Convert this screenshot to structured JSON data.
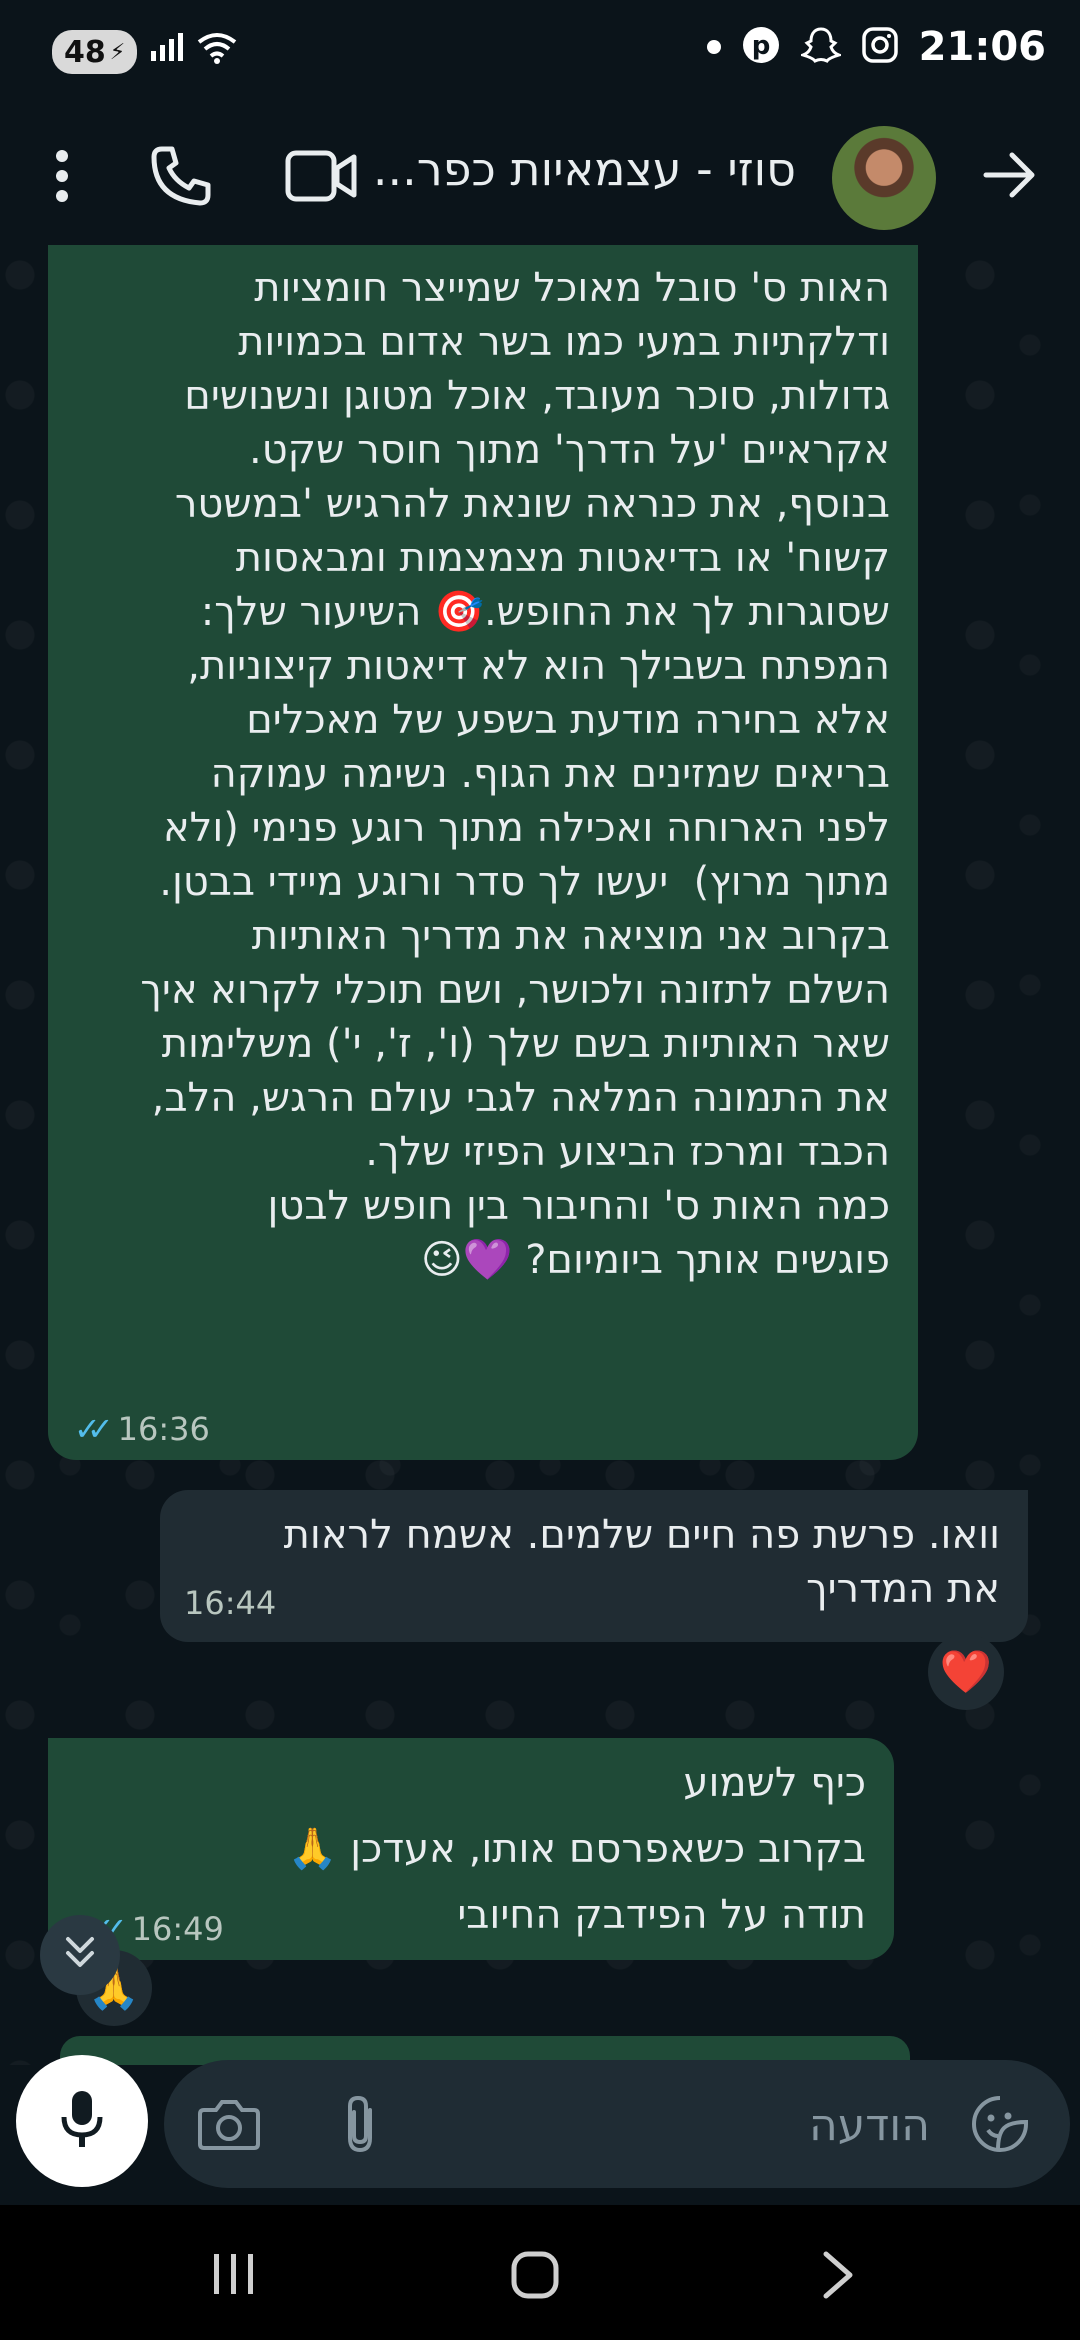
{
  "status_bar": {
    "battery": "48",
    "time": "21:06"
  },
  "header": {
    "title": "סוזי - עצמאיות כפר..."
  },
  "messages": [
    {
      "direction": "outgoing",
      "text": "האות ס' סובל מאוכל שמייצר חומציות\nודלקתיות במעי כמו בשר אדום בכמויות\nגדולות, סוכר מעובד, אוכל מטוגן ונשנושים\nאקראיים 'על הדרך' מתוך חוסר שקט.\nבנוסף, את כנראה שונאת להרגיש 'במשטר\nקשוח' או בדיאטות מצמצמות ומבאסות\nשסוגרות לך את החופש.🎯 השיעור שלך:\nהמפתח בשבילך הוא לא דיאטות קיצוניות,\nאלא בחירה מודעת בשפע של מאכלים\nבריאים שמזינים את הגוף. נשימה עמוקה\nלפני הארוחה ואכילה מתוך רוגע פנימי (ולא\nמתוך מרוץ)  יעשו לך סדר ורוגע מיידי בבטן.\nבקרוב אני מוציאה את מדריך האותיות\nהשלם לתזונה ולכושר, ושם תוכלי לקרוא איך\nשאר האותיות בשם שלך (ו', ז', י') משלימות\nאת התמונה המלאה לגבי עולם הרגש, הלב,\nהכבד ומרכז הביצוע הפיזי שלך.\nכמה האות ס' והחיבור בין חופש לבטן\nפוגשים אותך ביומיום? 💜😉",
      "time": "16:36"
    },
    {
      "direction": "incoming",
      "text": "וואו. פרשת פה חיים שלמים. אשמח לראות\nאת המדריך",
      "time": "16:44",
      "reaction": "❤️"
    },
    {
      "direction": "outgoing",
      "text": "כיף לשמוע\nבקרוב כשאפרסם אותו, אעדכן 🙏\nתודה על הפידבק החיובי",
      "time": "16:49",
      "reaction": "🙏"
    }
  ],
  "composer": {
    "placeholder": "הודעה"
  }
}
